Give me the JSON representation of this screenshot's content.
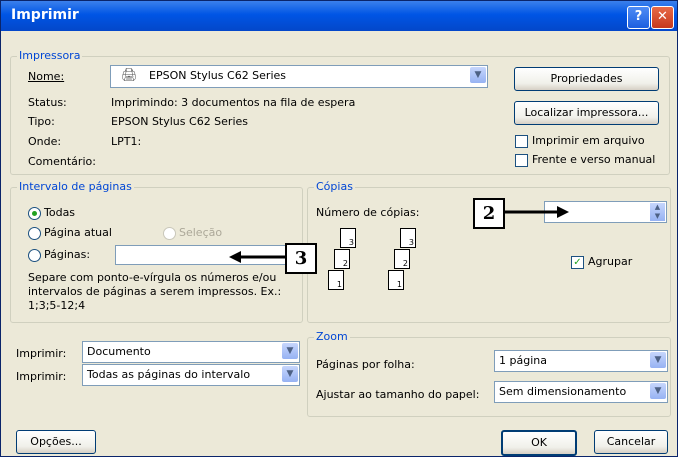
{
  "window": {
    "title": "Imprimir"
  },
  "printer": {
    "legend": "Impressora",
    "name_label": "Nome:",
    "name_value": "EPSON Stylus C62 Series",
    "status_label": "Status:",
    "status_value": "Imprimindo: 3 documentos na fila de espera",
    "type_label": "Tipo:",
    "type_value": "EPSON Stylus C62 Series",
    "where_label": "Onde:",
    "where_value": "LPT1:",
    "comment_label": "Comentário:",
    "properties_button": "Propriedades",
    "find_printer_button": "Localizar impressora...",
    "print_to_file": "Imprimir em arquivo",
    "manual_duplex": "Frente e verso manual"
  },
  "page_range": {
    "legend": "Intervalo de páginas",
    "all": "Todas",
    "current_page": "Página atual",
    "selection": "Seleção",
    "pages": "Páginas:",
    "help_line1": "Separe com ponto-e-vírgula os números e/ou",
    "help_line2": "intervalos de páginas a serem impressos.  Ex.:",
    "help_line3": "1;3;5-12;4"
  },
  "copies": {
    "legend": "Cópias",
    "number_label": "Número de cópias:",
    "collate": "Agrupar",
    "page_numbers": [
      "3",
      "2",
      "1"
    ]
  },
  "print_what": {
    "label": "Imprimir:",
    "value": "Documento"
  },
  "print_range": {
    "label": "Imprimir:",
    "value": "Todas as páginas do intervalo"
  },
  "zoom": {
    "legend": "Zoom",
    "pages_per_sheet_label": "Páginas por folha:",
    "pages_per_sheet_value": "1 página",
    "scale_label": "Ajustar ao tamanho do papel:",
    "scale_value": "Sem dimensionamento"
  },
  "buttons": {
    "options": "Opções...",
    "ok": "OK",
    "cancel": "Cancelar"
  },
  "callouts": {
    "two": "2",
    "three": "3"
  }
}
